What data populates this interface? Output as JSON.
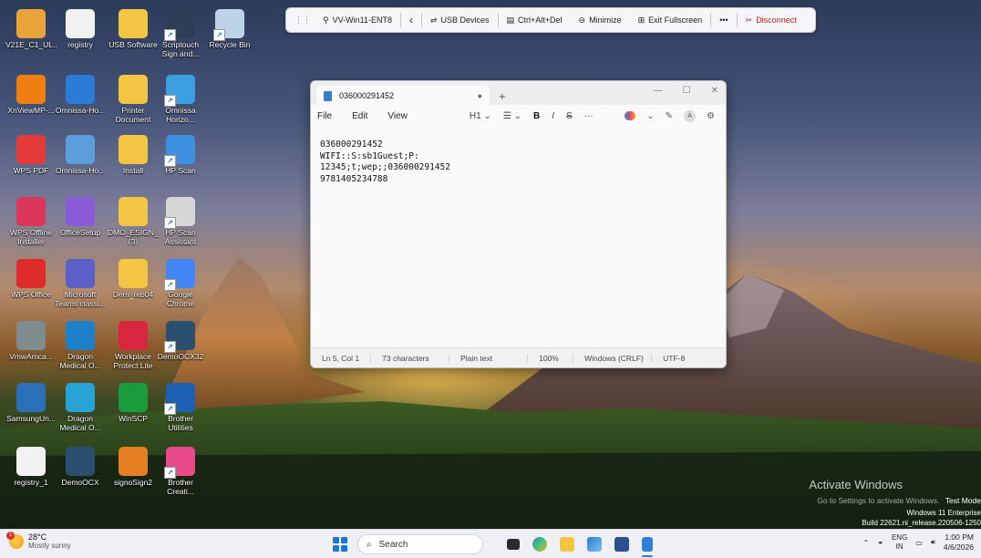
{
  "desktop": {
    "icons": [
      {
        "label": "V21E_C1_UL...",
        "icon": "folder-app-icon",
        "color": "#e8a33a"
      },
      {
        "label": "registry",
        "icon": "document-icon",
        "color": "#f2f2f2"
      },
      {
        "label": "USB Software",
        "icon": "folder-icon",
        "color": "#f4c542"
      },
      {
        "label": "Scriptouch Sign and...",
        "icon": "signature-pad-icon",
        "color": "#2d3f55"
      },
      {
        "label": "Recycle Bin",
        "icon": "recycle-bin-icon",
        "color": "#bcd3e8"
      },
      {
        "label": "XnViewMP-...",
        "icon": "xnview-icon",
        "color": "#f07f12"
      },
      {
        "label": "Omnissa-Ho...",
        "icon": "omnissa-icon",
        "color": "#2c7bd6"
      },
      {
        "label": "Printer Document",
        "icon": "folder-icon",
        "color": "#f4c542"
      },
      {
        "label": "Omnissa Horizo...",
        "icon": "omnissa-horizon-icon",
        "color": "#3aa0e0"
      },
      {
        "label": "WPS PDF",
        "icon": "wps-pdf-icon",
        "color": "#e43a3a"
      },
      {
        "label": "Omnissa-Ho...",
        "icon": "installer-icon",
        "color": "#5c9edb"
      },
      {
        "label": "Install",
        "icon": "folder-icon",
        "color": "#f4c542"
      },
      {
        "label": "HP Scan",
        "icon": "hp-scan-icon",
        "color": "#3d8fe0"
      },
      {
        "label": "WPS Offline Installer",
        "icon": "wps-installer-icon",
        "color": "#d9365a"
      },
      {
        "label": "OfficeSetup",
        "icon": "office-icon",
        "color": "#8a5ad8"
      },
      {
        "label": "DMO_ESIGN_... (3)",
        "icon": "folder-icon",
        "color": "#f4c542"
      },
      {
        "label": "HP Scan Assistant",
        "icon": "scanner-icon",
        "color": "#d6d6d6"
      },
      {
        "label": "WPS Office",
        "icon": "wps-office-icon",
        "color": "#e02b2b"
      },
      {
        "label": "Microsoft Teams classi...",
        "icon": "teams-icon",
        "color": "#5b5fc7"
      },
      {
        "label": "Dem_reb04",
        "icon": "folder-icon",
        "color": "#f4c542"
      },
      {
        "label": "Google Chrome",
        "icon": "chrome-icon",
        "color": "#4285f4"
      },
      {
        "label": "VmwAmca...",
        "icon": "vmware-icon",
        "color": "#7f8c8d"
      },
      {
        "label": "Dragon Medical O...",
        "icon": "dragon-icon",
        "color": "#1e7fc9"
      },
      {
        "label": "Workplace Protect Lite",
        "icon": "workplace-icon",
        "color": "#d7263d"
      },
      {
        "label": "DemoOCX32",
        "icon": "demo-ocx-icon",
        "color": "#2b4f6e"
      },
      {
        "label": "SamsungUn...",
        "icon": "samsung-icon",
        "color": "#2a6fb8"
      },
      {
        "label": "Dragon Medical O...",
        "icon": "dragon-icon",
        "color": "#27a3d6"
      },
      {
        "label": "WinSCP",
        "icon": "winscp-icon",
        "color": "#1b9c3c"
      },
      {
        "label": "Brother Utilities",
        "icon": "brother-utilities-icon",
        "color": "#1c5fb3"
      },
      {
        "label": "registry_1",
        "icon": "document-icon",
        "color": "#f2f2f2"
      },
      {
        "label": "DemoOCX",
        "icon": "demo-ocx-icon",
        "color": "#2b4f6e"
      },
      {
        "label": "signoSign2",
        "icon": "signosign-icon",
        "color": "#e67e22"
      },
      {
        "label": "Brother Creati...",
        "icon": "brother-creative-icon",
        "color": "#e84a8a"
      }
    ]
  },
  "remote_toolbar": {
    "session": "VV-Win11-ENT8",
    "usb": "USB Devices",
    "cad": "Ctrl+Alt+Del",
    "minimize": "Minimize",
    "fullscreen": "Exit Fullscreen",
    "more": "•••",
    "disconnect": "Disconnect"
  },
  "notepad": {
    "tab_title": "036000291452",
    "menu": {
      "file": "File",
      "edit": "Edit",
      "view": "View"
    },
    "format": {
      "heading": "H1",
      "bold": "B",
      "italic": "I",
      "strike": "S",
      "more": "···"
    },
    "lines": [
      "036000291452",
      "WIFI::S:sb1Guest;P:",
      "12345;t;wep;;036000291452",
      "9781405234788"
    ],
    "status": {
      "position": "Ln 5, Col 1",
      "chars": "73 characters",
      "format": "Plain text",
      "zoom": "100%",
      "eol": "Windows (CRLF)",
      "encoding": "UTF-8"
    }
  },
  "watermark": {
    "title": "Activate Windows",
    "subtitle": "Go to Settings to activate Windows.",
    "mode": "Test Mode",
    "edition": "Windows 11 Enterprise",
    "build": "Build 22621.ni_release.220506-1250"
  },
  "taskbar": {
    "weather": {
      "temp": "28°C",
      "desc": "Mostly sunny",
      "badge": "1"
    },
    "search_placeholder": "Search",
    "tray": {
      "lang": "ENG",
      "region": "IN",
      "time": "1:00 PM",
      "date": "4/6/2026"
    }
  }
}
